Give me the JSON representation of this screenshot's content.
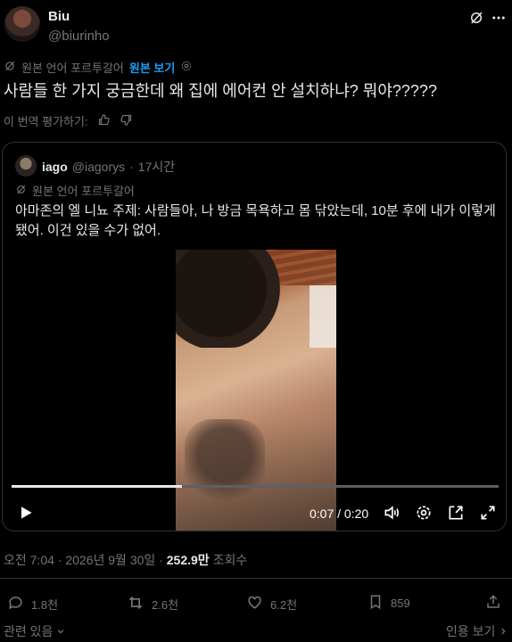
{
  "author": {
    "name": "Biu",
    "handle": "@biurinho"
  },
  "translation": {
    "label": "원본 언어 포르투갈어",
    "show_original": "원본 보기"
  },
  "tweet": {
    "text": "사람들 한 가지 궁금한데 왜 집에 에어컨 안 설치하냐? 뭐야?????"
  },
  "rate": {
    "label": "이 번역 평가하기:"
  },
  "quote": {
    "name": "iago",
    "handle": "@iagorys",
    "dot": "·",
    "time": "17시간",
    "translation_label": "원본 언어 포르투갈어",
    "text": "아마존의 엘 니뇨 주제: 사람들아, 나 방금 목욕하고 몸 닦았는데, 10분 후에 내가 이렇게 됐어. 이건 있을 수가 없어."
  },
  "video": {
    "current": "0:07",
    "separator": "/",
    "duration": "0:20",
    "progress_fraction": 0.35
  },
  "meta": {
    "time": "오전 7:04",
    "dot": "·",
    "date": "2026년 9월 30일",
    "dot2": "·",
    "views": "252.9만",
    "views_label": "조회수"
  },
  "actions": {
    "replies": "1.8천",
    "reposts": "2.6천",
    "likes": "6.2천",
    "bookmarks": "859"
  },
  "bottom": {
    "relevant": "관련 있음",
    "quotes": "인용 보기"
  },
  "icons": [
    "grok-icon",
    "more-icon",
    "translate-icon",
    "settings-icon",
    "thumb-up-icon",
    "thumb-down-icon",
    "play-icon",
    "volume-icon",
    "video-settings-icon",
    "pip-icon",
    "fullscreen-icon",
    "reply-icon",
    "repost-icon",
    "like-icon",
    "bookmark-icon",
    "share-icon",
    "chevron-down-icon",
    "chevron-right-icon"
  ],
  "colors": {
    "background": "#000000",
    "text": "#e7e9ea",
    "muted": "#71767b",
    "accent": "#1d9bf0",
    "border": "#2f3336"
  }
}
